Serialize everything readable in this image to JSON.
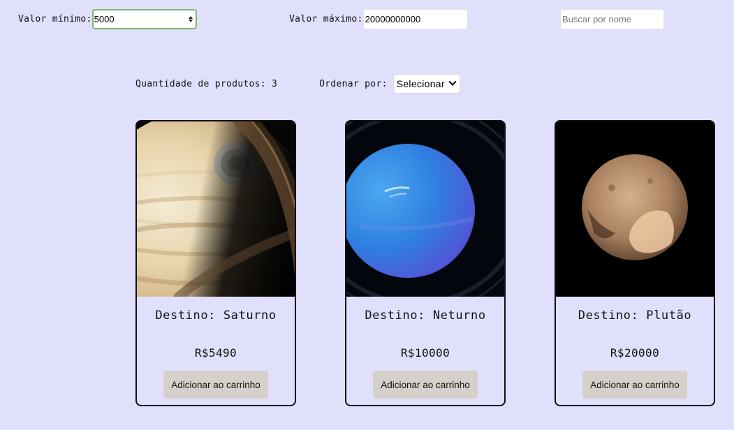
{
  "filters": {
    "min_label": "Valor mínimo:",
    "min_value": "5000",
    "max_label": "Valor máximo:",
    "max_value": "20000000000",
    "search_placeholder": "Buscar por nome"
  },
  "toolbar": {
    "quantity_text": "Quantidade de produtos: 3",
    "sort_label": "Ordenar por:",
    "sort_selected": "Selecionar"
  },
  "products": [
    {
      "title": "Destino: Saturno",
      "price": "R$5490",
      "button": "Adicionar ao carrinho",
      "image": "saturn-image"
    },
    {
      "title": "Destino: Neturno",
      "price": "R$10000",
      "button": "Adicionar ao carrinho",
      "image": "neptune-image"
    },
    {
      "title": "Destino: Plutão",
      "price": "R$20000",
      "button": "Adicionar ao carrinho",
      "image": "pluto-image"
    }
  ],
  "colors": {
    "background": "#e0e0fc",
    "button": "#d5d0c9",
    "focus_border": "#7ab86b"
  }
}
